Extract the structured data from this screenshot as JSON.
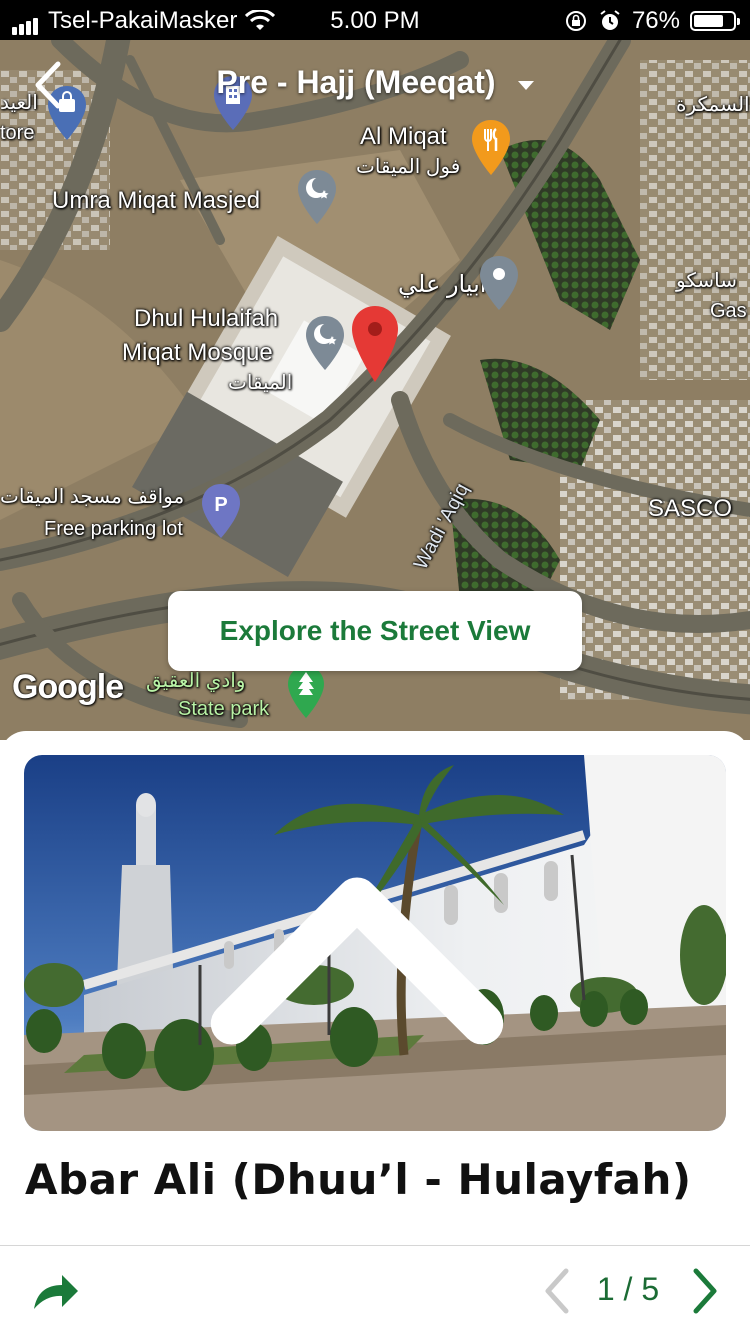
{
  "status_bar": {
    "carrier": "Tsel-PakaiMasker",
    "time": "5.00 PM",
    "battery": "76%",
    "battery_level": 0.76
  },
  "header": {
    "title": "Pre - Hajj (Meeqat)"
  },
  "map": {
    "labels": {
      "al_miqat": "Al Miqat",
      "al_miqat_ar": "فول الميقات",
      "umra_masjed": "Umra Miqat Masjed",
      "dhul_1": "Dhul Hulaifah",
      "dhul_2": "Miqat Mosque",
      "dhul_ar": "الميقات",
      "abyar_ar": "أبيار علي",
      "parking_ar": "مواقف مسجد الميقات",
      "parking": "Free parking lot",
      "wadi": "Wadi 'Aqiq",
      "sasco": "SASCO",
      "state_park_ar": "وادي العقيق",
      "state_park": "State park",
      "store_ar": "العيد",
      "store": "tore",
      "top_right_ar": "السمكرة",
      "gas_ar": "ساسكو",
      "gas": "Gas"
    },
    "street_view_button": "Explore the Street View",
    "google_logo": "Google"
  },
  "place": {
    "title": "Abar Ali (Dhuu’l - Hulayfah)",
    "pager": "1 / 5"
  },
  "colors": {
    "accent_green": "#1b7a3a",
    "pin_red": "#e53935"
  }
}
